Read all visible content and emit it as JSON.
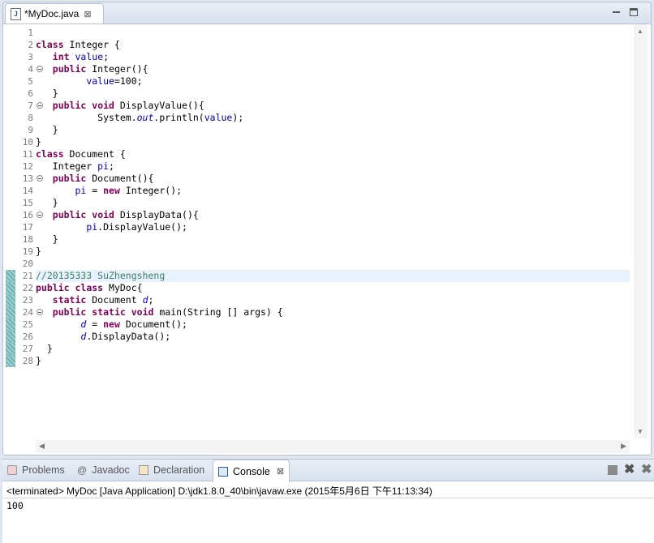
{
  "editor": {
    "tab_label": "*MyDoc.java",
    "tab_close": "⊠",
    "lines": [
      {
        "n": "1",
        "html": ""
      },
      {
        "n": "2",
        "html": "<span class='kw'>class</span> Integer {"
      },
      {
        "n": "3",
        "html": "   <span class='kw'>int</span> <span class='fld'>value</span>;"
      },
      {
        "n": "4",
        "html": "   <span class='kw'>public</span> Integer(){",
        "fold": true
      },
      {
        "n": "5",
        "html": "         <span class='fld'>value</span>=100;"
      },
      {
        "n": "6",
        "html": "   }"
      },
      {
        "n": "7",
        "html": "   <span class='kw'>public</span> <span class='kw'>void</span> DisplayValue(){",
        "fold": true
      },
      {
        "n": "8",
        "html": "           System.<span class='sfld'>out</span>.println(<span class='fld'>value</span>);"
      },
      {
        "n": "9",
        "html": "   }"
      },
      {
        "n": "10",
        "html": "}"
      },
      {
        "n": "11",
        "html": "<span class='kw'>class</span> Document {"
      },
      {
        "n": "12",
        "html": "   Integer <span class='fld'>pi</span>;"
      },
      {
        "n": "13",
        "html": "   <span class='kw'>public</span> Document(){",
        "fold": true
      },
      {
        "n": "14",
        "html": "       <span class='fld'>pi</span> = <span class='kw'>new</span> Integer();"
      },
      {
        "n": "15",
        "html": "   }"
      },
      {
        "n": "16",
        "html": "   <span class='kw'>public</span> <span class='kw'>void</span> DisplayData(){",
        "fold": true
      },
      {
        "n": "17",
        "html": "         <span class='fld'>pi</span>.DisplayValue();"
      },
      {
        "n": "18",
        "html": "   }"
      },
      {
        "n": "19",
        "html": "}"
      },
      {
        "n": "20",
        "html": ""
      },
      {
        "n": "21",
        "html": "<span class='cmt'>//20135333 SuZhengsheng</span>",
        "highlight": true
      },
      {
        "n": "22",
        "html": "<span class='kw'>public</span> <span class='kw'>class</span> MyDoc{"
      },
      {
        "n": "23",
        "html": "   <span class='kw'>static</span> Document <span class='sfld'>d</span>;"
      },
      {
        "n": "24",
        "html": "   <span class='kw'>public</span> <span class='kw'>static</span> <span class='kw'>void</span> main(String [] args) {",
        "fold": true
      },
      {
        "n": "25",
        "html": "        <span class='sfld'>d</span> = <span class='kw'>new</span> Document();"
      },
      {
        "n": "26",
        "html": "        <span class='sfld'>d</span>.DisplayData();"
      },
      {
        "n": "27",
        "html": "  }"
      },
      {
        "n": "28",
        "html": "}"
      }
    ],
    "changed_lines_start": 20,
    "changed_lines_end": 27
  },
  "views": {
    "tabs": [
      {
        "label": "Problems",
        "icon": "problems-icon"
      },
      {
        "label": "Javadoc",
        "icon": "javadoc-icon"
      },
      {
        "label": "Declaration",
        "icon": "declaration-icon"
      },
      {
        "label": "Console",
        "icon": "console-icon",
        "active": true
      }
    ],
    "console_close": "⊠",
    "javadoc_glyph": "@",
    "tool_x": "✖",
    "tool_xx": "✖",
    "status": "<terminated> MyDoc [Java Application] D:\\jdk1.8.0_40\\bin\\javaw.exe (2015年5月6日 下午11:13:34)",
    "output": "100"
  },
  "scroll": {
    "up": "▲",
    "down": "▼",
    "left": "◀",
    "right": "▶"
  }
}
